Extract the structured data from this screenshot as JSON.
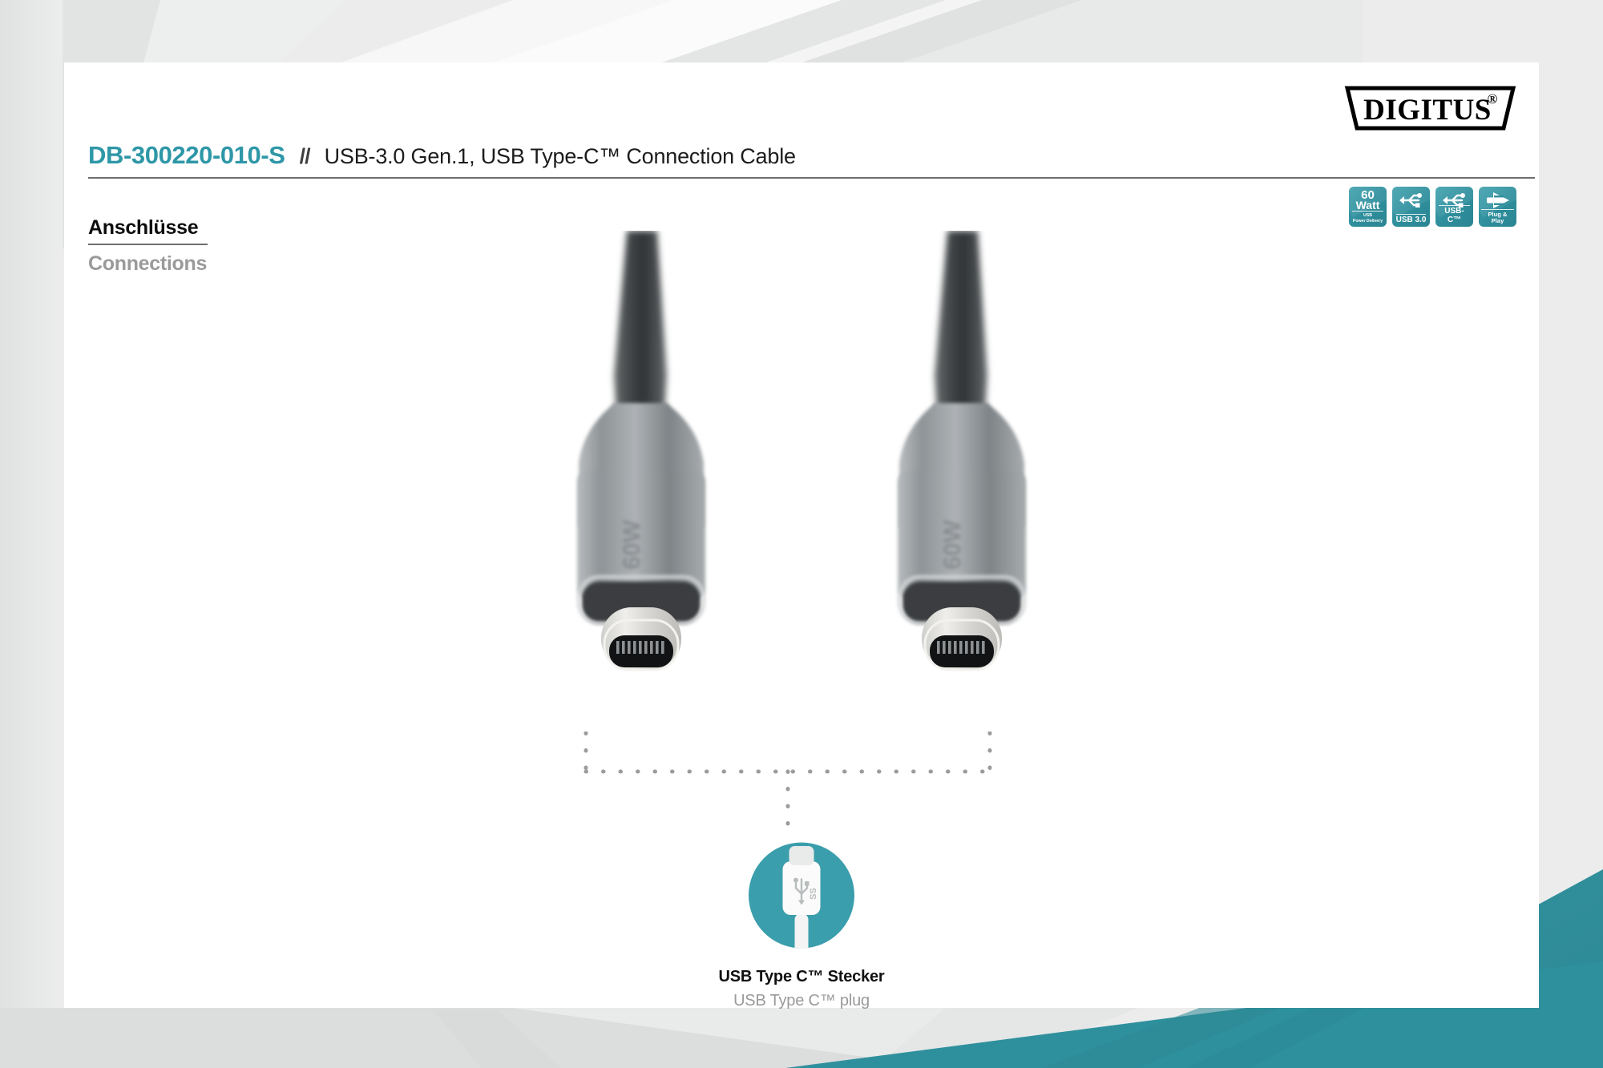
{
  "page": {
    "background_color": "#eceded",
    "card_color": "#ffffff",
    "accent_teal": "#2e97a7",
    "banner_teal": "#2e8e9c"
  },
  "brand": {
    "logo_text": "DIGITUS",
    "logo_registered": "®"
  },
  "header": {
    "sku": "DB-300220-010-S",
    "separator": "//",
    "title": "USB-3.0 Gen.1, USB Type-C™ Connection Cable"
  },
  "section": {
    "label_de": "Anschlüsse",
    "label_en": "Connections"
  },
  "badges": [
    {
      "name": "power-delivery-badge",
      "value": "60",
      "unit": "Watt",
      "sub_line1": "USB",
      "sub_line2": "Power Delivery",
      "icon": "watt-text"
    },
    {
      "name": "usb30-badge",
      "label": "USB 3.0",
      "icon": "usb-trident-icon"
    },
    {
      "name": "usbc-badge",
      "label": "USB-C™",
      "icon": "usb-trident-icon"
    },
    {
      "name": "plug-and-play-badge",
      "label": "Plug & Play",
      "icon": "plug-play-icon"
    }
  ],
  "product_image": {
    "alt": "Two USB Type-C connectors of a USB 3.0 cable",
    "connector_marking": "60W",
    "connectors": [
      {
        "name": "usb-c-connector-left",
        "position": "left"
      },
      {
        "name": "usb-c-connector-right",
        "position": "right"
      }
    ]
  },
  "callout": {
    "icon": "usb-type-c-plug-icon",
    "icon_marking": "SS",
    "label_de": "USB Type C™ Stecker",
    "label_en": "USB Type C™ plug"
  }
}
